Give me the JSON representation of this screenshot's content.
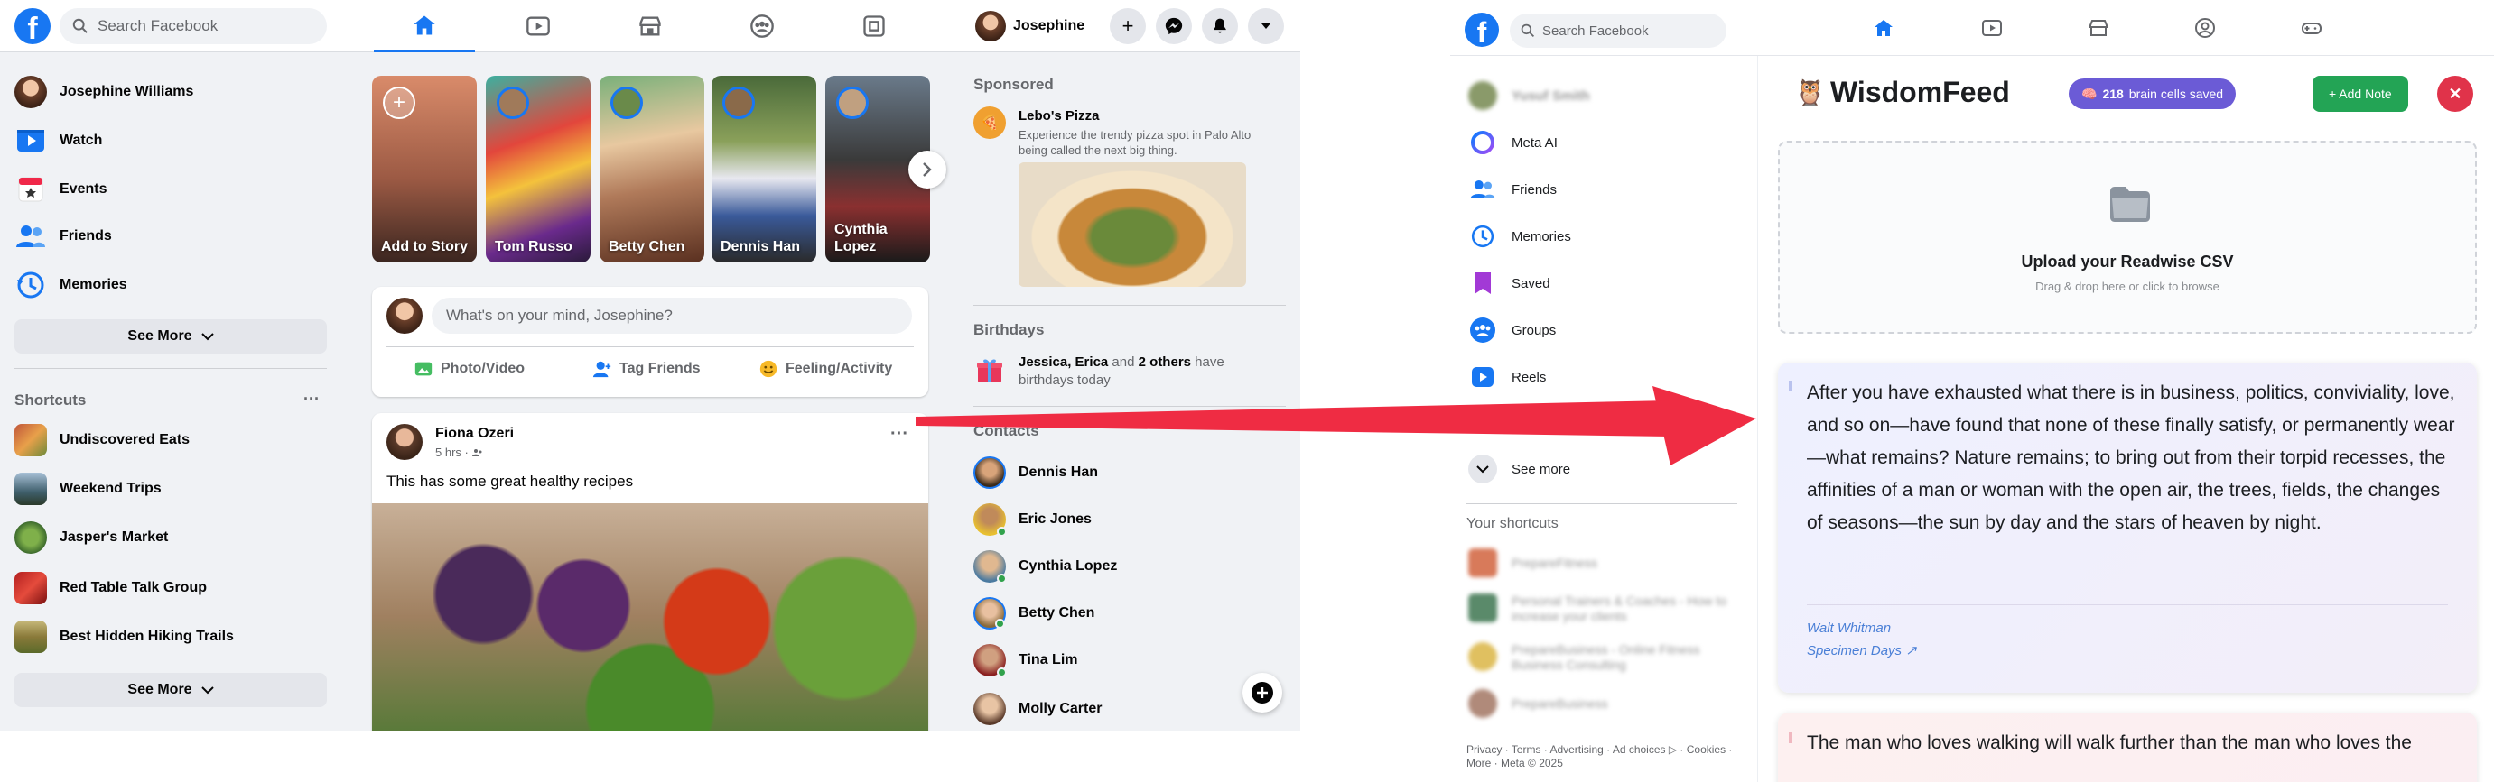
{
  "left": {
    "search_placeholder": "Search Facebook",
    "profile_name": "Josephine",
    "sidebar": [
      {
        "label": "Josephine Williams",
        "icon": "avatar"
      },
      {
        "label": "Watch",
        "icon": "watch-icon"
      },
      {
        "label": "Events",
        "icon": "events-icon"
      },
      {
        "label": "Friends",
        "icon": "friends-icon"
      },
      {
        "label": "Memories",
        "icon": "memories-icon"
      }
    ],
    "see_more": "See More",
    "shortcuts_title": "Shortcuts",
    "shortcuts_menu": "···",
    "shortcuts": [
      {
        "label": "Undiscovered Eats"
      },
      {
        "label": "Weekend Trips"
      },
      {
        "label": "Jasper's Market"
      },
      {
        "label": "Red Table Talk Group"
      },
      {
        "label": "Best Hidden Hiking Trails"
      }
    ],
    "see_more_2": "See More",
    "stories": [
      {
        "label": "Add to Story"
      },
      {
        "label": "Tom Russo"
      },
      {
        "label": "Betty Chen"
      },
      {
        "label": "Dennis Han"
      },
      {
        "label": "Cynthia Lopez"
      }
    ],
    "composer_placeholder": "What's on your mind, Josephine?",
    "composer_actions": [
      {
        "label": "Photo/Video"
      },
      {
        "label": "Tag Friends"
      },
      {
        "label": "Feeling/Activity"
      }
    ],
    "post": {
      "author": "Fiona Ozeri",
      "time": "5 hrs ·",
      "text": "This has some great healthy recipes",
      "menu": "···"
    },
    "sponsored_title": "Sponsored",
    "ad": {
      "name": "Lebo's Pizza",
      "desc": "Experience the trendy pizza spot in Palo Alto being called the next big thing."
    },
    "birthdays_title": "Birthdays",
    "birthday_names": "Jessica, Erica",
    "birthday_and": " and ",
    "birthday_others": "2 others",
    "birthday_suffix": " have birthdays today",
    "contacts_title": "Contacts",
    "contacts": [
      {
        "name": "Dennis Han"
      },
      {
        "name": "Eric Jones"
      },
      {
        "name": "Cynthia Lopez"
      },
      {
        "name": "Betty Chen"
      },
      {
        "name": "Tina Lim"
      },
      {
        "name": "Molly Carter"
      }
    ]
  },
  "right": {
    "search_placeholder": "Search Facebook",
    "profile_blurred": "Yusuf Smith",
    "nav": [
      {
        "label": "Meta AI"
      },
      {
        "label": "Friends"
      },
      {
        "label": "Memories"
      },
      {
        "label": "Saved"
      },
      {
        "label": "Groups"
      },
      {
        "label": "Reels"
      }
    ],
    "see_more": "See more",
    "shortcuts_title": "Your shortcuts",
    "shortcuts_blurred": [
      {
        "label": "PrepareFitness"
      },
      {
        "label": "Personal Trainers & Coaches - How to increase your clients"
      },
      {
        "label": "PrepareBusiness - Online Fitness Business Consulting"
      },
      {
        "label": "PrepareBusiness"
      }
    ],
    "footer": "Privacy · Terms · Advertising · Ad choices ▷ · Cookies · More · Meta © 2025"
  },
  "widget": {
    "logo": "🦉",
    "title": "WisdomFeed",
    "badge_icon": "🧠",
    "badge_count": "218",
    "badge_text": "brain cells saved",
    "add_note": "+ Add Note",
    "close": "✕",
    "upload_title": "Upload your Readwise CSV",
    "upload_hint": "Drag & drop here or click to browse",
    "quotes": [
      {
        "text": "After you have exhausted what there is in business, politics, conviviality, love, and so on—have found that none of these finally satisfy, or permanently wear—what remains? Nature remains; to bring out from their torpid recesses, the affinities of a man or woman with the open air, the trees, fields, the changes of seasons—the sun by day and the stars of heaven by night.",
        "author": "Walt Whitman",
        "source": "Specimen Days ↗"
      },
      {
        "text": "The man who loves walking will walk further than the man who loves the",
        "author": "",
        "source": ""
      }
    ]
  },
  "colors": {
    "fb_blue": "#1877f2",
    "fb_bg": "#f0f2f5",
    "badge_purple": "#6b5bd6",
    "add_green": "#23a455",
    "close_red": "#e0334a",
    "arrow_red": "#ef2c43",
    "quote_link": "#4a7fd6"
  }
}
